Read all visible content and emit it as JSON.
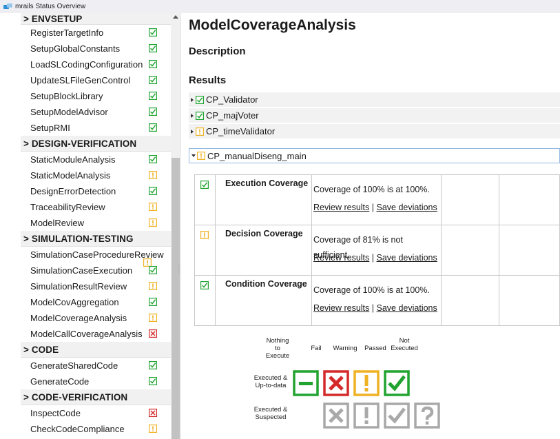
{
  "window": {
    "title": "mrails Status Overview"
  },
  "colors": {
    "passed": "#21a330",
    "fail": "#d42a2a",
    "warning": "#efb225",
    "grey": "#a9a9a9"
  },
  "sidebar": {
    "sections": [
      {
        "title": "> ENVSETUP",
        "items": [
          {
            "label": "RegisterTargetInfo",
            "status": "passed"
          },
          {
            "label": "SetupGlobalConstants",
            "status": "passed"
          },
          {
            "label": "LoadSLCodingConfiguration",
            "status": "passed"
          },
          {
            "label": "UpdateSLFileGenControl",
            "status": "passed"
          },
          {
            "label": "SetupBlockLibrary",
            "status": "passed"
          },
          {
            "label": "SetupModelAdvisor",
            "status": "passed"
          },
          {
            "label": "SetupRMI",
            "status": "passed"
          }
        ]
      },
      {
        "title": "> DESIGN-VERIFICATION",
        "items": [
          {
            "label": "StaticModuleAnalysis",
            "status": "passed"
          },
          {
            "label": "StaticModelAnalysis",
            "status": "warning"
          },
          {
            "label": "DesignErrorDetection",
            "status": "passed"
          },
          {
            "label": "TraceabilityReview",
            "status": "warning"
          },
          {
            "label": "ModelReview",
            "status": "warning"
          }
        ]
      },
      {
        "title": "> SIMULATION-TESTING",
        "items": [
          {
            "label": "SimulationCaseProcedureReview",
            "status": "warning"
          },
          {
            "label": "SimulationCaseExecution",
            "status": "passed"
          },
          {
            "label": "SimulationResultReview",
            "status": "warning"
          },
          {
            "label": "ModelCovAggregation",
            "status": "passed"
          },
          {
            "label": "ModelCoverageAnalysis",
            "status": "warning"
          },
          {
            "label": "ModelCallCoverageAnalysis",
            "status": "fail"
          }
        ]
      },
      {
        "title": "> CODE",
        "items": [
          {
            "label": "GenerateSharedCode",
            "status": "passed"
          },
          {
            "label": "GenerateCode",
            "status": "passed"
          }
        ]
      },
      {
        "title": "> CODE-VERIFICATION",
        "items": [
          {
            "label": "InspectCode",
            "status": "fail"
          },
          {
            "label": "CheckCodeCompliance",
            "status": "warning"
          }
        ]
      }
    ]
  },
  "main": {
    "title": "ModelCoverageAnalysis",
    "description_heading": "Description",
    "results_heading": "Results",
    "results": [
      {
        "label": "CP_Validator",
        "status": "passed",
        "expanded": false
      },
      {
        "label": "CP_majVoter",
        "status": "passed",
        "expanded": false
      },
      {
        "label": "CP_timeValidator",
        "status": "warning",
        "expanded": false
      },
      {
        "label": "CP_manualDiseng_main",
        "status": "warning",
        "expanded": true
      }
    ],
    "coverage": [
      {
        "status": "passed",
        "name": "Execution Coverage",
        "text": "Coverage of 100% is at 100%.",
        "review": "Review results",
        "sep": "|",
        "save": "Save deviations"
      },
      {
        "status": "warning",
        "name": "Decision Coverage",
        "text": "Coverage of 81% is not sufficient.",
        "review": "Review results",
        "sep": "|",
        "save": "Save deviations"
      },
      {
        "status": "passed",
        "name": "Condition Coverage",
        "text": "Coverage of 100% is at 100%.",
        "review": "Review results",
        "sep": "|",
        "save": "Save deviations"
      }
    ]
  },
  "legend": {
    "columns": [
      "Nothing\nto Execute",
      "Fail",
      "Warning",
      "Passed",
      "Not\nExecuted"
    ],
    "rows": [
      "Executed &\nUp-to-data",
      "Executed &\nSuspected"
    ]
  }
}
